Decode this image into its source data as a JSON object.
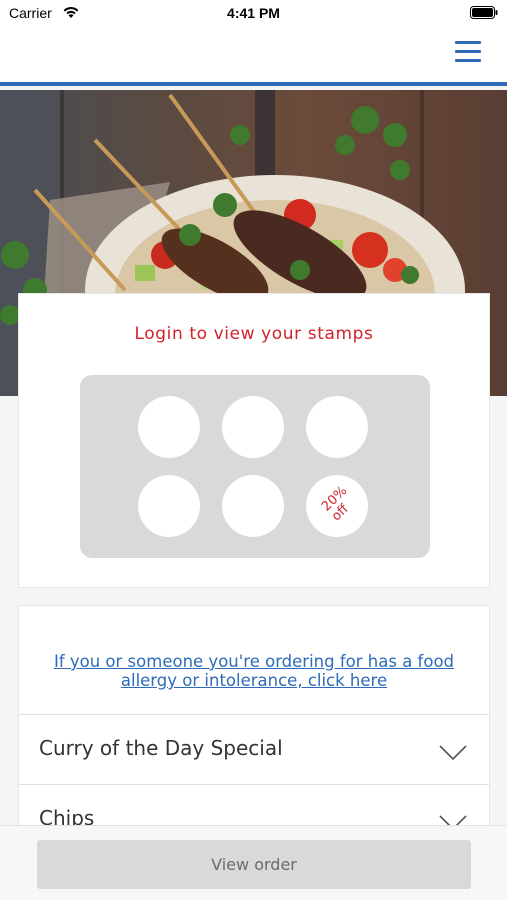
{
  "status_bar": {
    "carrier": "Carrier",
    "time": "4:41 PM"
  },
  "nav": {
    "menu_icon": "hamburger-menu-icon",
    "accent_color": "#2e6bb8"
  },
  "hero": {
    "description_icon": "food-photo"
  },
  "stamp_card": {
    "title": "Login to view your stamps",
    "title_color": "#d0232a",
    "reward_line1": "20%",
    "reward_line2": "off",
    "stamps_total": 6
  },
  "menu": {
    "allergy_link": "If you or someone you're ordering for has a food allergy or intolerance, click here",
    "items": [
      {
        "label": "Curry of the Day Special"
      },
      {
        "label": "Chips"
      }
    ]
  },
  "footer": {
    "view_order_label": "View order"
  }
}
